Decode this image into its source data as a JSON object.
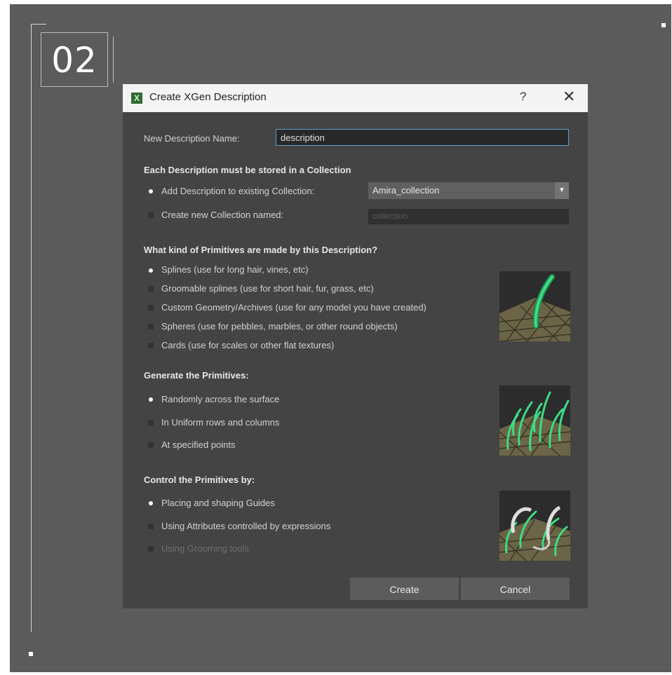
{
  "step_number": "02",
  "dialog": {
    "title": "Create XGen Description",
    "help_label": "?",
    "close_label": "✕",
    "app_icon": "xgen-app-icon",
    "name_label": "New Description Name:",
    "name_value": "description",
    "collection_header": "Each Description must be stored in a Collection",
    "collection_options": [
      {
        "label": "Add Description to existing Collection:",
        "selected": true
      },
      {
        "label": "Create new Collection named:",
        "selected": false
      }
    ],
    "existing_collection_value": "Amira_collection",
    "new_collection_placeholder": "collection",
    "primitives_header": "What kind of Primitives are made by this Description?",
    "primitives_options": [
      {
        "label": "Splines (use for long hair, vines, etc)",
        "selected": true
      },
      {
        "label": "Groomable splines (use for short hair, fur, grass, etc)",
        "selected": false
      },
      {
        "label": "Custom Geometry/Archives (use for any model you have created)",
        "selected": false
      },
      {
        "label": "Spheres (use for pebbles, marbles, or other round objects)",
        "selected": false
      },
      {
        "label": "Cards (use for scales or other flat textures)",
        "selected": false
      }
    ],
    "generate_header": "Generate the Primitives:",
    "generate_options": [
      {
        "label": "Randomly across the surface",
        "selected": true
      },
      {
        "label": "In Uniform rows and columns",
        "selected": false
      },
      {
        "label": "At specified points",
        "selected": false
      }
    ],
    "control_header": "Control the Primitives by:",
    "control_options": [
      {
        "label": "Placing and shaping Guides",
        "selected": true
      },
      {
        "label": "Using Attributes controlled by expressions",
        "selected": false
      },
      {
        "label": "Using Grooming tools",
        "selected": false,
        "disabled": true
      }
    ],
    "create_label": "Create",
    "cancel_label": "Cancel"
  },
  "colors": {
    "frame_bg": "#5b5b5b",
    "dialog_bg": "#444444",
    "accent_green": "#3ddc84",
    "input_focus_border": "#5fa0c7"
  }
}
